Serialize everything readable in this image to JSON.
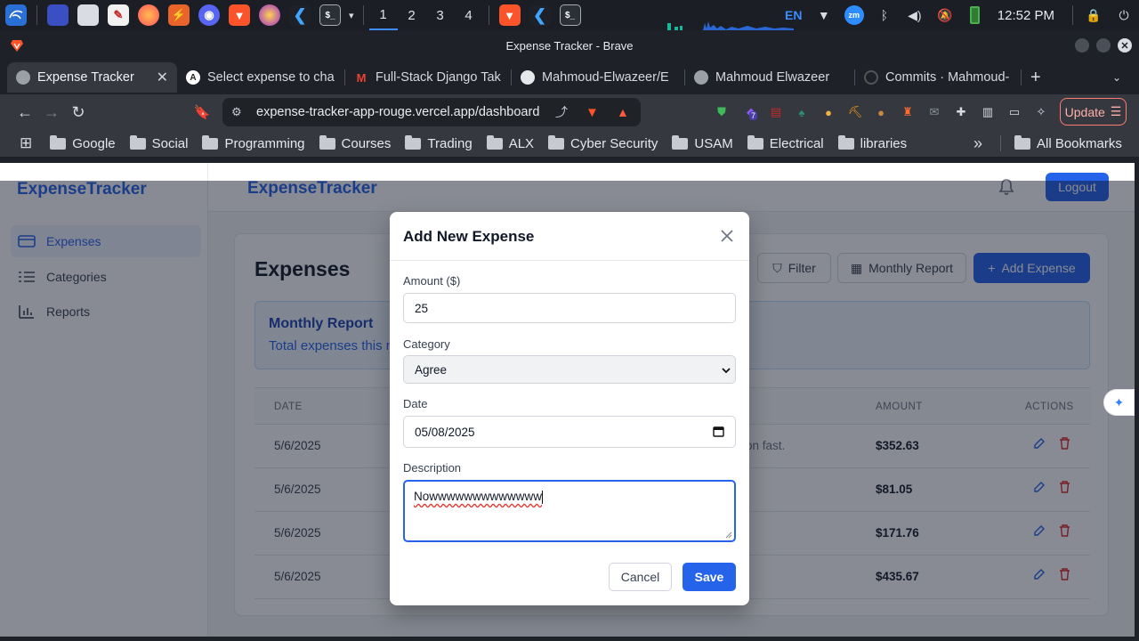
{
  "taskbar": {
    "workspaces": [
      "1",
      "2",
      "3",
      "4"
    ],
    "active_workspace": "1",
    "lang": "EN",
    "clock": "12:52 PM"
  },
  "browser": {
    "window_title": "Expense Tracker - Brave",
    "tabs": [
      {
        "label": "Expense Tracker",
        "active": true
      },
      {
        "label": "Select expense to cha"
      },
      {
        "label": "Full-Stack Django Tak"
      },
      {
        "label": "Mahmoud-Elwazeer/E"
      },
      {
        "label": "Mahmoud Elwazeer"
      },
      {
        "label": "Commits · Mahmoud-"
      }
    ],
    "url": "expense-tracker-app-rouge.vercel.app/dashboard",
    "update_label": "Update",
    "ext_badge": "7",
    "bookmarks": [
      "Google",
      "Social",
      "Programming",
      "Courses",
      "Trading",
      "ALX",
      "Cyber Security",
      "USAM",
      "Electrical",
      "libraries"
    ],
    "all_bookmarks": "All Bookmarks",
    "more_bookmarks": "»"
  },
  "app": {
    "brand": "ExpenseTracker",
    "logout_label": "Logout",
    "sidebar": [
      {
        "label": "Expenses",
        "active": true
      },
      {
        "label": "Categories"
      },
      {
        "label": "Reports"
      }
    ],
    "page_title": "Expenses",
    "filter_label": "Filter",
    "monthly_report_label": "Monthly Report",
    "add_expense_label": "Add Expense",
    "report": {
      "title": "Monthly Report",
      "text": "Total expenses this m"
    },
    "table": {
      "headers": {
        "date": "DATE",
        "amount": "AMOUNT",
        "actions": "ACTIONS"
      },
      "rows": [
        {
          "date": "5/6/2025",
          "desc_tail": "on fast.",
          "amount": "$352.63"
        },
        {
          "date": "5/6/2025",
          "desc_tail": "",
          "amount": "$81.05"
        },
        {
          "date": "5/6/2025",
          "desc_tail": "",
          "amount": "$171.76"
        },
        {
          "date": "5/6/2025",
          "desc_tail": "",
          "amount": "$435.67"
        }
      ]
    }
  },
  "modal": {
    "title": "Add New Expense",
    "amount_label": "Amount ($)",
    "amount_value": "25",
    "category_label": "Category",
    "category_value": "Agree",
    "date_label": "Date",
    "date_value": "05/08/2025",
    "description_label": "Description",
    "description_value": "Nowwwwwwwwwwwww",
    "cancel_label": "Cancel",
    "save_label": "Save"
  },
  "colors": {
    "accent": "#2563eb",
    "page_bg": "#f3f4f6",
    "delete": "#dc2626"
  }
}
